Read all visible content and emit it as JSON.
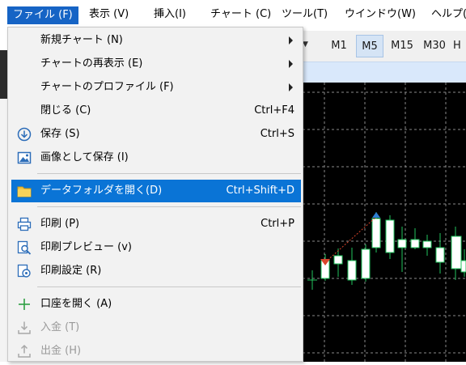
{
  "menubar": {
    "items": [
      {
        "label": "ファイル (F)"
      },
      {
        "label": "表示 (V)"
      },
      {
        "label": "挿入(I)"
      },
      {
        "label": "チャート (C)"
      },
      {
        "label": "ツール(T)"
      },
      {
        "label": "ウインドウ(W)"
      },
      {
        "label": "ヘルプ(H)"
      }
    ]
  },
  "toolbar": {
    "timeframes": [
      {
        "label": "M1"
      },
      {
        "label": "M5"
      },
      {
        "label": "M15"
      },
      {
        "label": "M30"
      },
      {
        "label": "H"
      }
    ],
    "selected": "M5"
  },
  "file_menu": {
    "items": [
      {
        "label": "新規チャート (N)",
        "shortcut": "",
        "submenu": true
      },
      {
        "label": "チャートの再表示 (E)",
        "shortcut": "",
        "submenu": true
      },
      {
        "label": "チャートのプロファイル (F)",
        "shortcut": "",
        "submenu": true
      },
      {
        "label": "閉じる (C)",
        "shortcut": "Ctrl+F4"
      },
      {
        "label": "保存 (S)",
        "shortcut": "Ctrl+S"
      },
      {
        "label": "画像として保存 (I)",
        "shortcut": ""
      },
      {
        "label": "データフォルダを開く(D)",
        "shortcut": "Ctrl+Shift+D"
      },
      {
        "label": "印刷 (P)",
        "shortcut": "Ctrl+P"
      },
      {
        "label": "印刷プレビュー (v)",
        "shortcut": ""
      },
      {
        "label": "印刷設定 (R)",
        "shortcut": ""
      },
      {
        "label": "口座を開く (A)",
        "shortcut": ""
      },
      {
        "label": "入金 (T)",
        "shortcut": "",
        "disabled": true
      },
      {
        "label": "出金 (H)",
        "shortcut": "",
        "disabled": true
      }
    ]
  },
  "colors": {
    "menu_active": "#1664c5",
    "highlight": "#0a74d6",
    "candle_up": "#ffffff",
    "candle_wick": "#22c55e",
    "marker_up": "#2e7fd1",
    "marker_down": "#d9442b"
  }
}
